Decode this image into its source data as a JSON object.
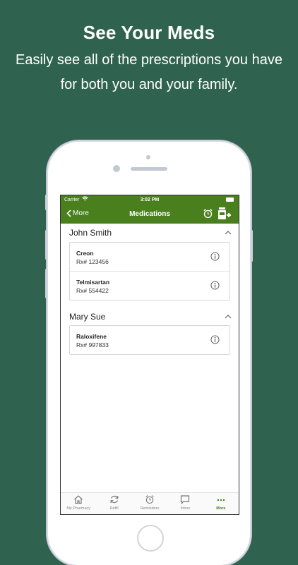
{
  "promo": {
    "title": "See Your Meds",
    "subtitle": "Easily see all of the prescriptions you have for both you and your family."
  },
  "status_bar": {
    "carrier": "Carrier",
    "time": "3:02 PM"
  },
  "nav": {
    "back_label": "More",
    "title": "Medications"
  },
  "groups": [
    {
      "name": "John Smith",
      "meds": [
        {
          "name": "Creon",
          "rx": "Rx# 123456"
        },
        {
          "name": "Telmisartan",
          "rx": "Rx# 554422"
        }
      ]
    },
    {
      "name": "Mary Sue",
      "meds": [
        {
          "name": "Raloxifene",
          "rx": "Rx# 997833"
        }
      ]
    }
  ],
  "tabs": [
    {
      "label": "My Pharmacy",
      "icon": "home-icon"
    },
    {
      "label": "Refill",
      "icon": "refresh-icon"
    },
    {
      "label": "Reminders",
      "icon": "alarm-clock-icon"
    },
    {
      "label": "Inbox",
      "icon": "chat-bubble-icon"
    },
    {
      "label": "More",
      "icon": "more-dots-icon",
      "active": true
    }
  ],
  "colors": {
    "background": "#2f6350",
    "app_green": "#4a7f1e"
  }
}
